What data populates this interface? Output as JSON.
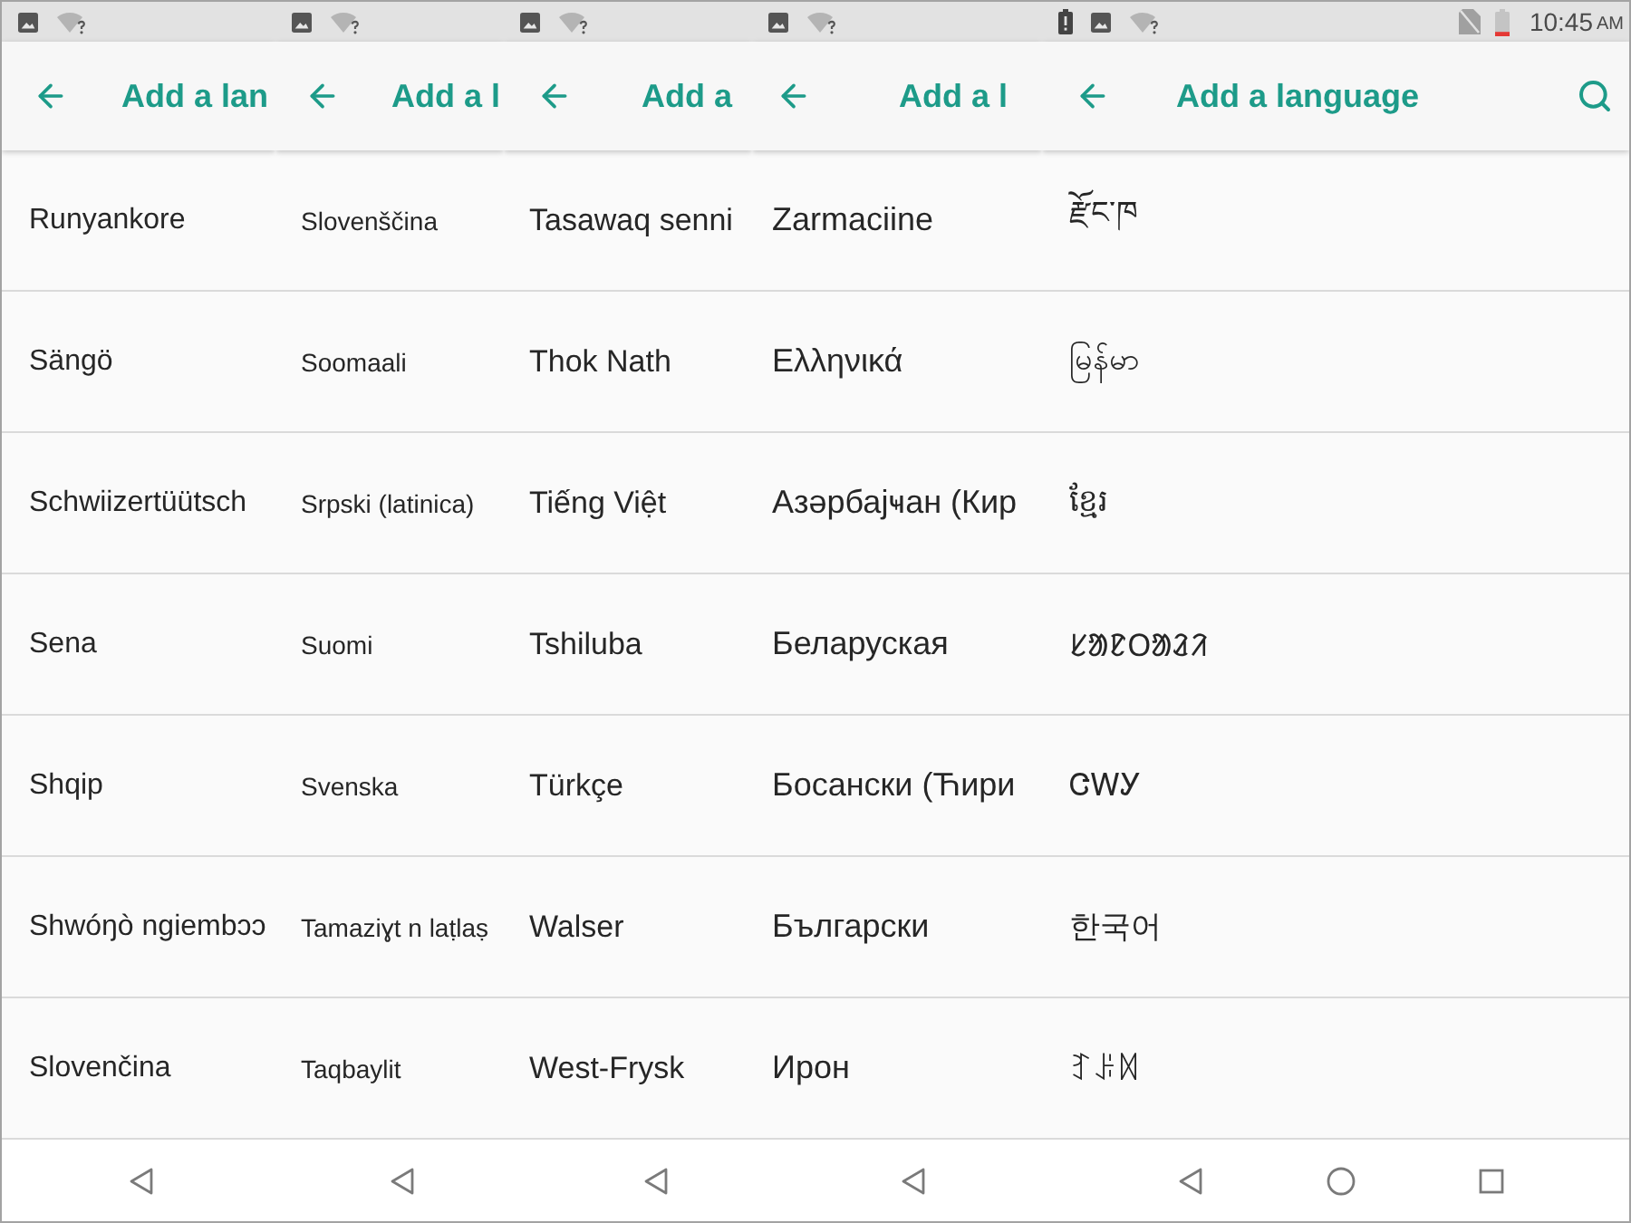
{
  "panels": [
    {
      "kind": "cropped",
      "toolbar": {
        "title": "Add a lan"
      },
      "languages": [
        "Runyankore",
        "Sängö",
        "Schwiizertüütsch",
        "Sena",
        "Shqip",
        "Shwóŋò ngiembɔɔ",
        "Slovenčina"
      ]
    },
    {
      "kind": "cropped",
      "toolbar": {
        "title": "Add a l"
      },
      "languages": [
        "Slovenščina",
        "Soomaali",
        "Srpski (latinica)",
        "Suomi",
        "Svenska",
        "Tamaziɣt n laṭlaṣ",
        "Taqbaylit"
      ]
    },
    {
      "kind": "cropped",
      "toolbar": {
        "title": "Add a"
      },
      "languages": [
        "Tasawaq senni",
        "Thok Nath",
        "Tiếng Việt",
        "Tshiluba",
        "Türkçe",
        "Walser",
        "West-Frysk"
      ]
    },
    {
      "kind": "cropped",
      "toolbar": {
        "title": "Add a l"
      },
      "languages": [
        "Zarmaciine",
        "Ελληνικά",
        "Азәрбајҹан (Кир",
        "Беларуская",
        "Босански (Ћири",
        "Български",
        "Ирон"
      ]
    },
    {
      "kind": "full",
      "status_bar": {
        "time": "10:45",
        "meridiem": "AM"
      },
      "toolbar": {
        "title": "Add a language"
      },
      "languages": [
        "རྫོང་ཁ",
        "မြန်မာ",
        "ខ្មែរ",
        "ᱥᱟᱱᱛᱟᱲᱤ",
        "ᏣᎳᎩ",
        "한국어",
        "ꆈꌠꉙ"
      ]
    }
  ]
}
